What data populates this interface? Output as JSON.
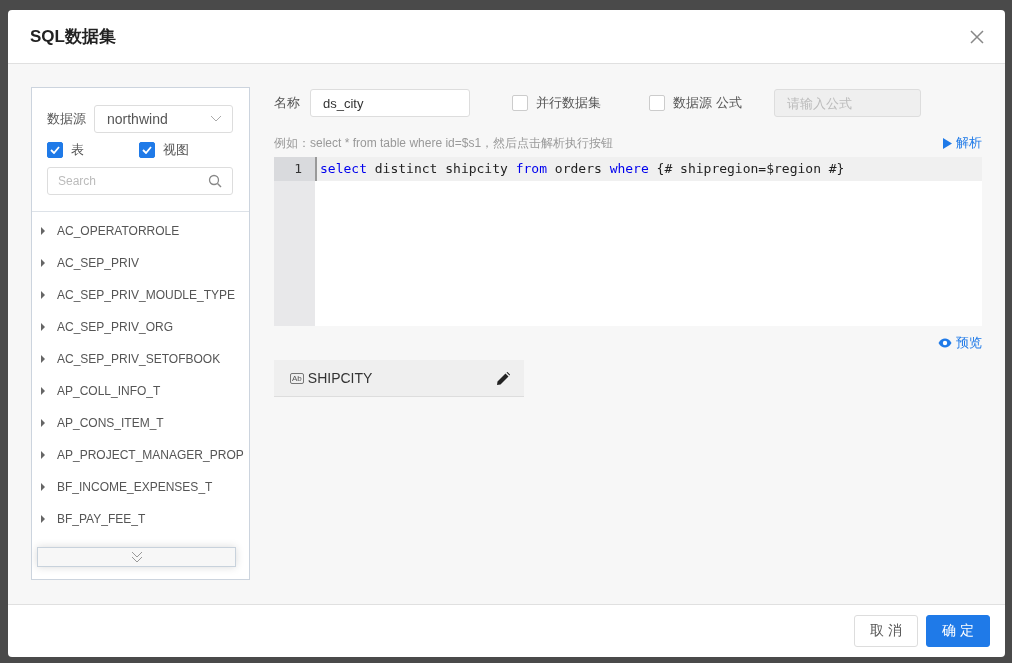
{
  "dialog": {
    "title": "SQL数据集"
  },
  "source_panel": {
    "label": "数据源",
    "datasource": "northwind",
    "filters": [
      {
        "label": "表",
        "checked": true
      },
      {
        "label": "视图",
        "checked": true
      }
    ],
    "search": {
      "placeholder": "Search"
    },
    "tables": [
      {
        "name": "AC_OPERATORROLE",
        "expanded": false
      },
      {
        "name": "AC_SEP_PRIV",
        "expanded": false
      },
      {
        "name": "AC_SEP_PRIV_MOUDLE_TYPE",
        "expanded": false
      },
      {
        "name": "AC_SEP_PRIV_ORG",
        "expanded": false
      },
      {
        "name": "AC_SEP_PRIV_SETOFBOOK",
        "expanded": false
      },
      {
        "name": "AP_COLL_INFO_T",
        "expanded": false
      },
      {
        "name": "AP_CONS_ITEM_T",
        "expanded": false
      },
      {
        "name": "AP_PROJECT_MANAGER_PROP",
        "expanded": false
      },
      {
        "name": "BF_INCOME_EXPENSES_T",
        "expanded": false
      },
      {
        "name": "BF_PAY_FEE_T",
        "expanded": false
      }
    ]
  },
  "form": {
    "name_label": "名称",
    "name_value": "ds_city",
    "options": [
      {
        "label": "并行数据集",
        "checked": false
      },
      {
        "label": "数据源 公式",
        "checked": false
      }
    ],
    "formula": {
      "placeholder": "请输入公式",
      "disabled": true
    },
    "hint": "例如：select * from table where id=$s1，然后点击解析执行按钮",
    "parse_button": "解析"
  },
  "editor": {
    "lines": [
      {
        "number": "1",
        "tokens": [
          {
            "kind": "keyword",
            "text": "select"
          },
          {
            "kind": "plain",
            "text": " distinct shipcity "
          },
          {
            "kind": "keyword",
            "text": "from"
          },
          {
            "kind": "plain",
            "text": " orders "
          },
          {
            "kind": "keyword",
            "text": "where"
          },
          {
            "kind": "plain",
            "text": " {# shipregion=$region #}"
          }
        ]
      }
    ]
  },
  "preview_button": "预览",
  "fields": [
    {
      "name": "SHIPCITY",
      "type_badge": "Ab"
    }
  ],
  "footer": {
    "buttons": [
      {
        "label": "取 消",
        "primary": false
      },
      {
        "label": "确 定",
        "primary": true
      }
    ]
  }
}
